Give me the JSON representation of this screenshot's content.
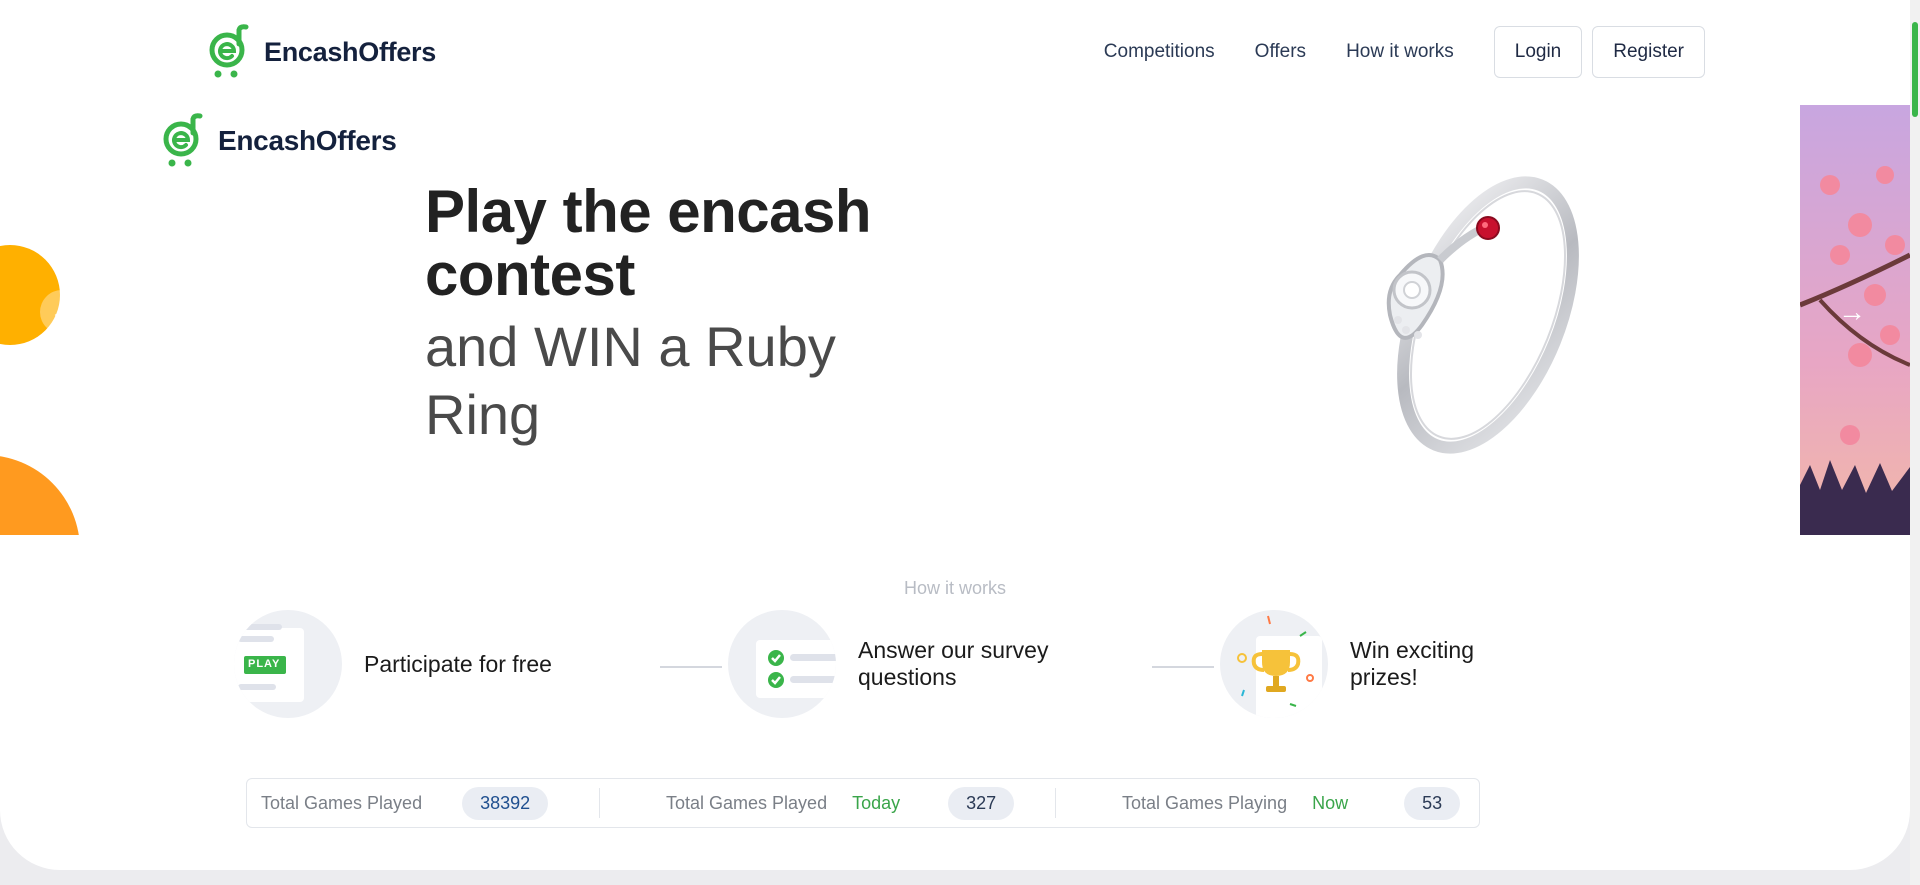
{
  "brand": {
    "name": "EncashOffers"
  },
  "nav": {
    "links": [
      "Competitions",
      "Offers",
      "How it works"
    ],
    "login_label": "Login",
    "register_label": "Register"
  },
  "hero": {
    "title": "Play the encash contest",
    "subtitle": "and WIN a Ruby Ring",
    "prev_icon": "←",
    "next_icon": "→"
  },
  "how_it_works": {
    "heading": "How it works",
    "steps": [
      {
        "label": "Participate for free",
        "icon": "play-document-icon"
      },
      {
        "label": "Answer our survey questions",
        "icon": "checklist-icon"
      },
      {
        "label": "Win exciting prizes!",
        "icon": "trophy-icon"
      }
    ],
    "play_badge": "PLAY"
  },
  "stats": [
    {
      "label": "Total Games Played",
      "when": "",
      "value": "38392"
    },
    {
      "label": "Total Games Played",
      "when": "Today",
      "value": "327"
    },
    {
      "label": "Total Games Playing",
      "when": "Now",
      "value": "53"
    }
  ],
  "colors": {
    "brand_green": "#3ab54a",
    "brand_navy": "#14213d",
    "accent_orange": "#ff9a1f",
    "accent_yellow": "#ffb000",
    "ruby": "#c8102e"
  }
}
